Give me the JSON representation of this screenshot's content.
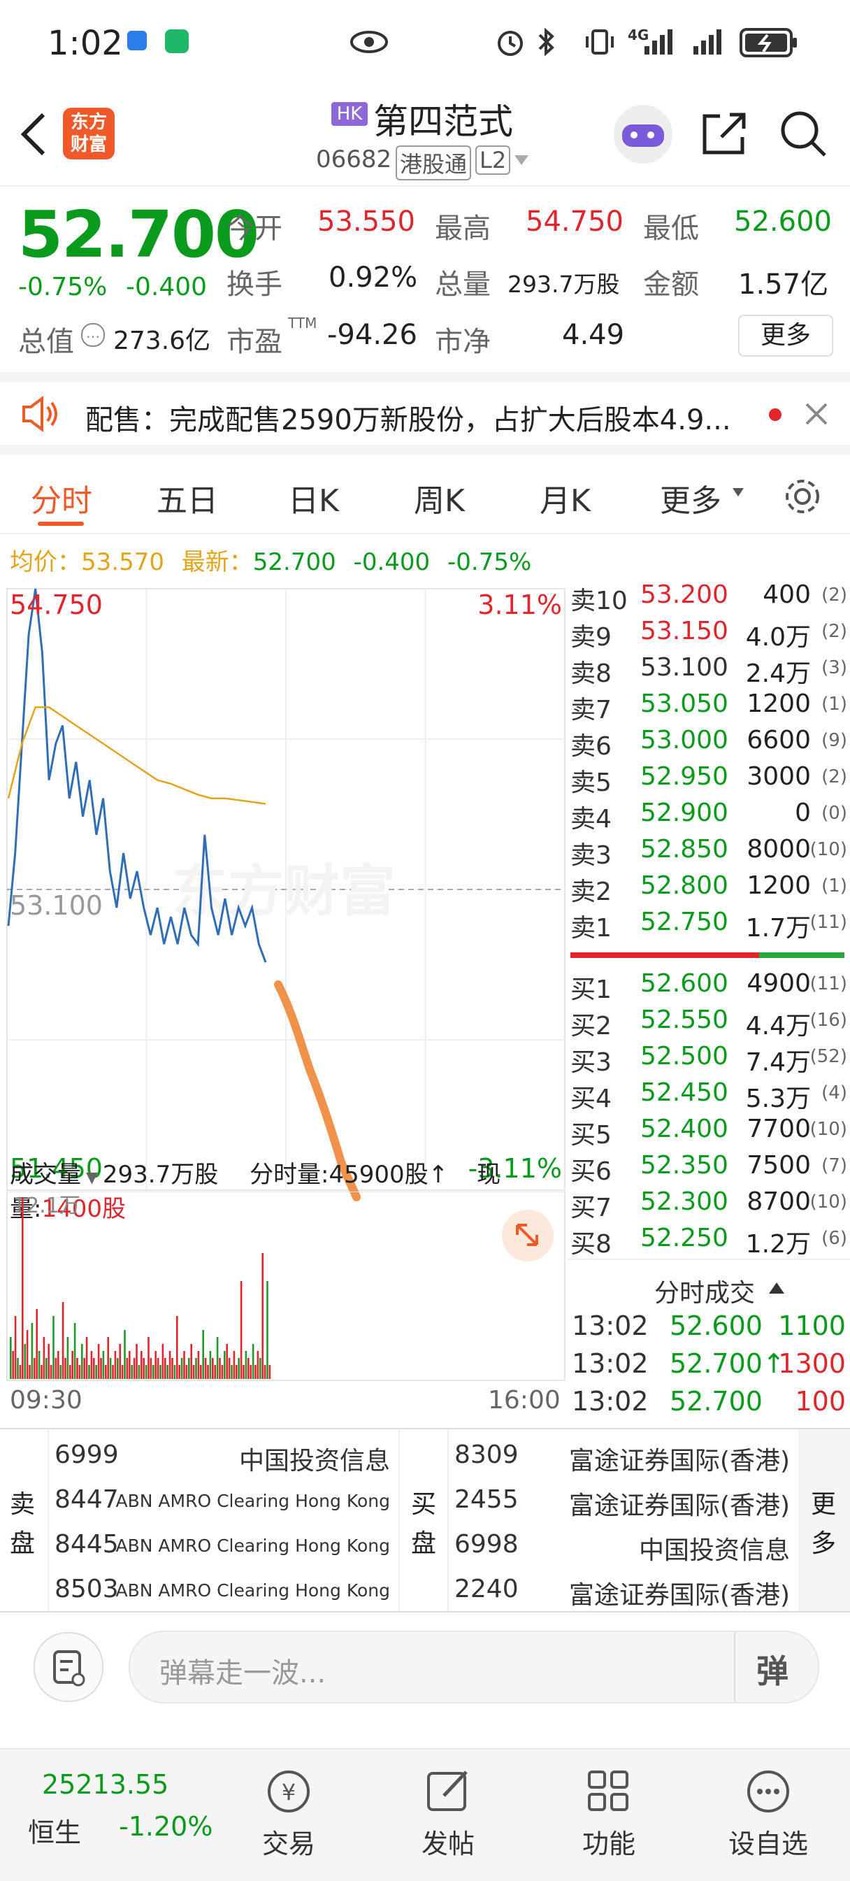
{
  "status_bar": {
    "time": "1:02",
    "net": "4G"
  },
  "header": {
    "market_badge": "HK",
    "stock_name": "第四范式",
    "code": "06682",
    "channel": "港股通",
    "level": "L2",
    "logo_text_1": "东方",
    "logo_text_2": "财富"
  },
  "quote": {
    "price": "52.700",
    "change_pct": "-0.75%",
    "change": "-0.400",
    "open_label": "今开",
    "open": "53.550",
    "high_label": "最高",
    "high": "54.750",
    "low_label": "最低",
    "low": "52.600",
    "turnover_label": "换手",
    "turnover": "0.92%",
    "volume_label": "总量",
    "volume": "293.7万股",
    "amount_label": "金额",
    "amount": "1.57亿",
    "mcap_label": "总值",
    "mcap": "273.6亿",
    "pe_label": "市盈",
    "pe_sup": "TTM",
    "pe": "-94.26",
    "pb_label": "市净",
    "pb": "4.49",
    "more_btn": "更多"
  },
  "notice": {
    "text": "配售：完成配售2590万新股份，占扩大后股本4.9..."
  },
  "tabs": [
    "分时",
    "五日",
    "日K",
    "周K",
    "月K",
    "更多"
  ],
  "intraday": {
    "avg_label": "均价：",
    "avg": "53.570",
    "latest_label": "最新：",
    "latest": "52.700",
    "chg": "-0.400",
    "pct": "-0.75%",
    "top_price": "54.750",
    "top_pct": "3.11%",
    "mid_price": "53.100",
    "bottom_price": "51.450",
    "bottom_pct": "-3.11%",
    "watermark": "东方财富",
    "time_start": "09:30",
    "time_end": "16:00"
  },
  "volume_bar": {
    "label": "成交量",
    "total": "293.7万股",
    "period_label": "分时量:",
    "period": "45900股↑",
    "current_label": "现量:",
    "current": "1400股",
    "max": "12.1万"
  },
  "sell_orders": [
    {
      "label": "卖10",
      "price": "53.200",
      "vol": "400",
      "cnt": "(2)"
    },
    {
      "label": "卖9",
      "price": "53.150",
      "vol": "4.0万",
      "cnt": "(2)"
    },
    {
      "label": "卖8",
      "price": "53.100",
      "vol": "2.4万",
      "cnt": "(3)"
    },
    {
      "label": "卖7",
      "price": "53.050",
      "vol": "1200",
      "cnt": "(1)"
    },
    {
      "label": "卖6",
      "price": "53.000",
      "vol": "6600",
      "cnt": "(9)"
    },
    {
      "label": "卖5",
      "price": "52.950",
      "vol": "3000",
      "cnt": "(2)"
    },
    {
      "label": "卖4",
      "price": "52.900",
      "vol": "0",
      "cnt": "(0)"
    },
    {
      "label": "卖3",
      "price": "52.850",
      "vol": "8000",
      "cnt": "(10)"
    },
    {
      "label": "卖2",
      "price": "52.800",
      "vol": "1200",
      "cnt": "(1)"
    },
    {
      "label": "卖1",
      "price": "52.750",
      "vol": "1.7万",
      "cnt": "(11)"
    }
  ],
  "buy_orders": [
    {
      "label": "买1",
      "price": "52.600",
      "vol": "4900",
      "cnt": "(11)"
    },
    {
      "label": "买2",
      "price": "52.550",
      "vol": "4.4万",
      "cnt": "(16)"
    },
    {
      "label": "买3",
      "price": "52.500",
      "vol": "7.4万",
      "cnt": "(52)"
    },
    {
      "label": "买4",
      "price": "52.450",
      "vol": "5.3万",
      "cnt": "(4)"
    },
    {
      "label": "买5",
      "price": "52.400",
      "vol": "7700",
      "cnt": "(10)"
    },
    {
      "label": "买6",
      "price": "52.350",
      "vol": "7500",
      "cnt": "(7)"
    },
    {
      "label": "买7",
      "price": "52.300",
      "vol": "8700",
      "cnt": "(10)"
    },
    {
      "label": "买8",
      "price": "52.250",
      "vol": "1.2万",
      "cnt": "(6)"
    }
  ],
  "trades": {
    "title": "分时成交",
    "rows": [
      {
        "time": "13:02",
        "price": "52.600",
        "vol": "1100"
      },
      {
        "time": "13:02",
        "price": "52.700↑",
        "vol": "1300"
      },
      {
        "time": "13:02",
        "price": "52.700",
        "vol": "100"
      }
    ]
  },
  "brokers": {
    "sell_label": "卖盘",
    "buy_label": "买盘",
    "more": "更多",
    "sell": [
      {
        "code": "6999",
        "name": "中国投资信息"
      },
      {
        "code": "8447",
        "name": "ABN AMRO Clearing Hong Kong"
      },
      {
        "code": "8445",
        "name": "ABN AMRO Clearing Hong Kong"
      },
      {
        "code": "8503",
        "name": "ABN AMRO Clearing Hong Kong"
      }
    ],
    "buy": [
      {
        "code": "8309",
        "name": "富途证券国际(香港)"
      },
      {
        "code": "2455",
        "name": "富途证券国际(香港)"
      },
      {
        "code": "6998",
        "name": "中国投资信息"
      },
      {
        "code": "2240",
        "name": "富途证券国际(香港)"
      }
    ]
  },
  "comment": {
    "placeholder": "弹幕走一波...",
    "danmu_btn": "弹"
  },
  "bottom_nav": {
    "index_value": "25213.55",
    "index_name": "恒生",
    "index_pct": "-1.20%",
    "items": [
      "交易",
      "发帖",
      "功能",
      "设自选"
    ]
  },
  "chart_data": {
    "type": "line",
    "price_range": [
      51.45,
      54.75
    ],
    "pct_range": [
      -3.11,
      3.11
    ],
    "prev_close": 53.1,
    "x_labels": [
      "09:30",
      "16:00"
    ],
    "series": [
      {
        "values": [
          52.9,
          53.3,
          53.9,
          54.5,
          54.75,
          54.4,
          53.7,
          53.9,
          54.0,
          53.6,
          53.8,
          53.5,
          53.7,
          53.4,
          53.6,
          53.2,
          53.0,
          53.3,
          53.05,
          53.2,
          53.0,
          52.85,
          53.0,
          52.8,
          52.95,
          52.8,
          53.0,
          52.85,
          52.8,
          53.4,
          53.0,
          52.85,
          53.05,
          52.85,
          53.0,
          52.9,
          53.0,
          52.8,
          52.7
        ]
      },
      {
        "values": [
          53.6,
          53.9,
          54.1,
          54.1,
          54.05,
          54.0,
          53.95,
          53.9,
          53.85,
          53.8,
          53.75,
          53.7,
          53.68,
          53.65,
          53.62,
          53.6,
          53.6,
          53.59,
          53.58,
          53.57
        ]
      }
    ]
  }
}
